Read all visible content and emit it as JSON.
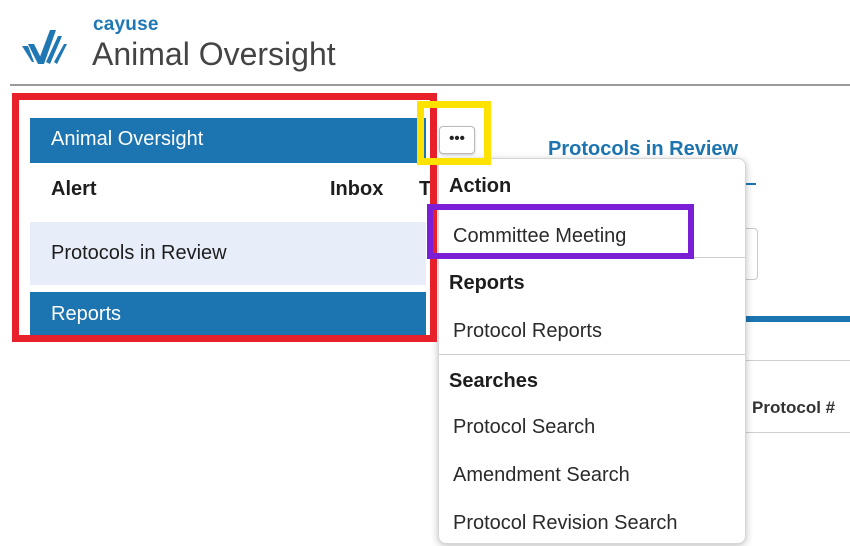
{
  "header": {
    "brand_small": "cayuse",
    "brand_title": "Animal Oversight"
  },
  "left_panel": {
    "title": "Animal Oversight",
    "tabs": [
      "Alert",
      "Inbox",
      "T"
    ],
    "items": [
      "Protocols in Review",
      "Reports"
    ]
  },
  "more_button": {
    "label": "•••"
  },
  "background": {
    "protocols_link": "Protocols in Review",
    "protocol_column": "Protocol #"
  },
  "dropdown": {
    "sections": [
      {
        "heading": "Action",
        "items": [
          "Committee Meeting"
        ]
      },
      {
        "heading": "Reports",
        "items": [
          "Protocol Reports"
        ]
      },
      {
        "heading": "Searches",
        "items": [
          "Protocol Search",
          "Amendment Search",
          "Protocol Revision Search"
        ]
      }
    ]
  },
  "colors": {
    "primary_blue": "#1c74b0",
    "highlight_red": "#e8202a",
    "highlight_yellow": "#ffe200",
    "highlight_purple": "#7b1fd6"
  }
}
